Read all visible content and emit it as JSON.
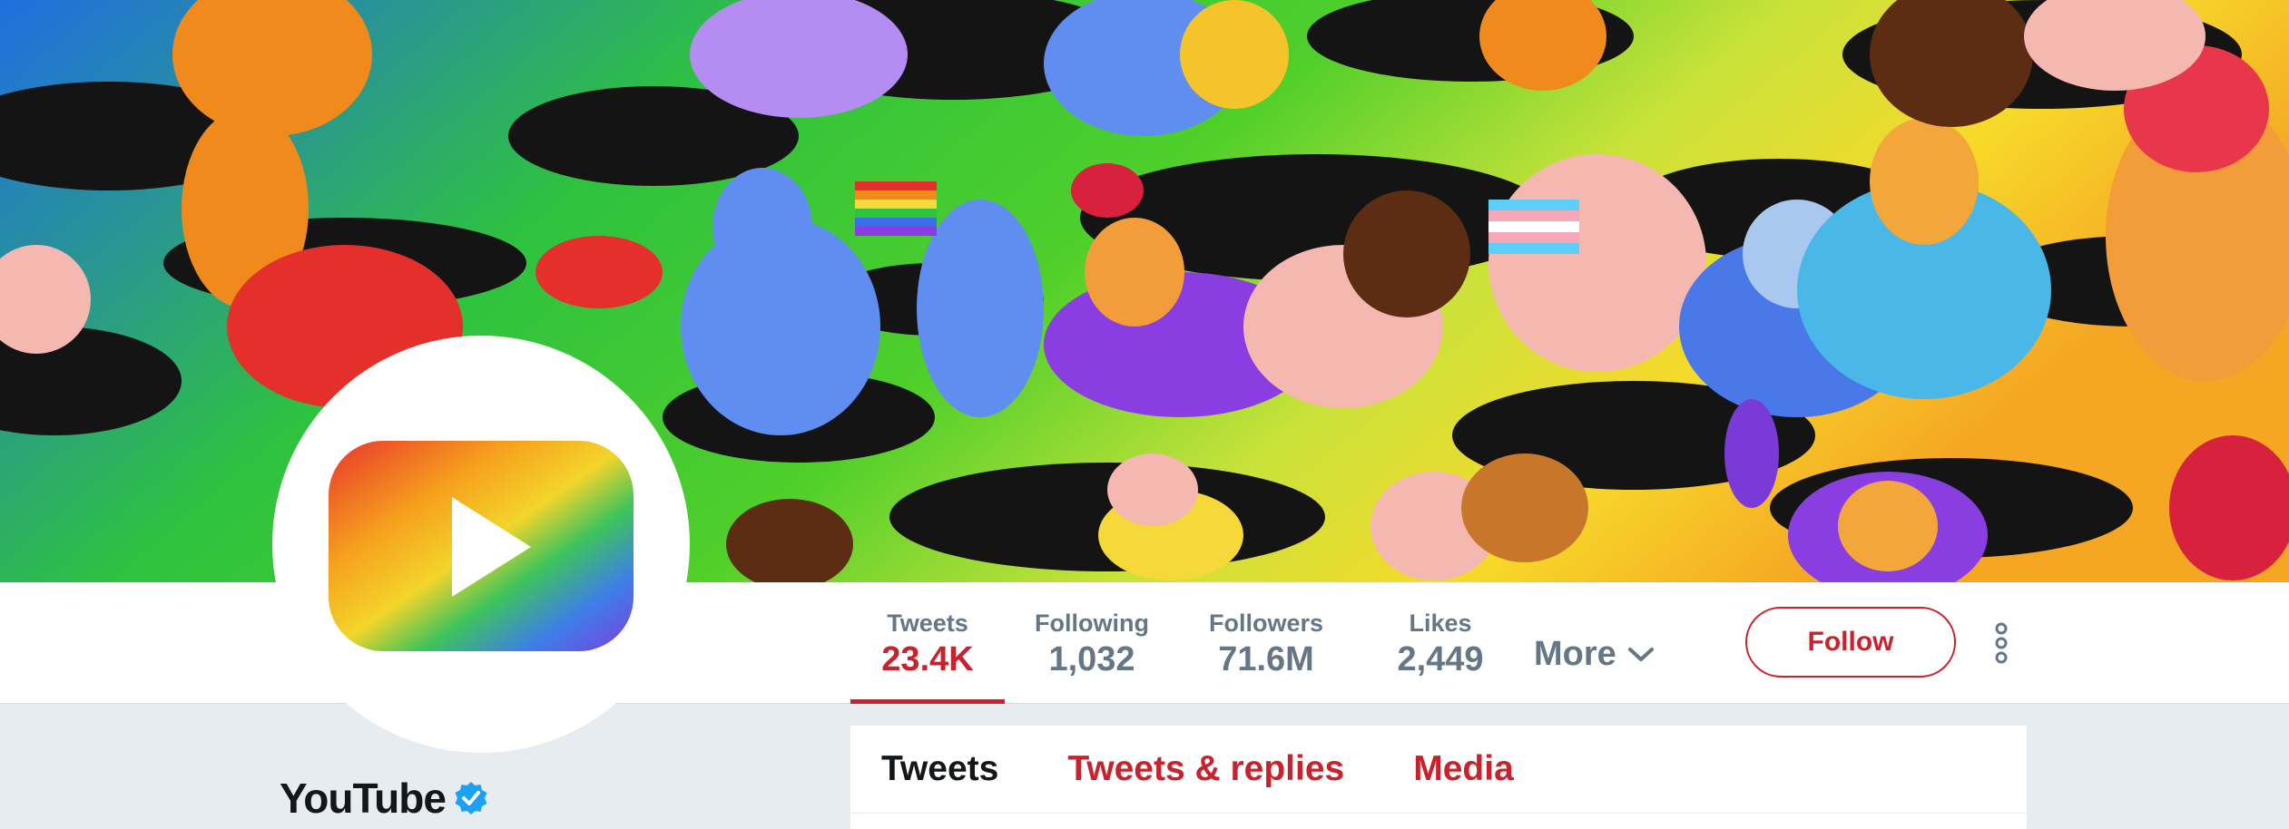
{
  "profile": {
    "name": "YouTube",
    "verified": true,
    "verified_icon": "verified-badge-icon",
    "avatar_icon": "youtube-play-logo"
  },
  "stats": [
    {
      "label": "Tweets",
      "value": "23.4K"
    },
    {
      "label": "Following",
      "value": "1,032"
    },
    {
      "label": "Followers",
      "value": "71.6M"
    },
    {
      "label": "Likes",
      "value": "2,449"
    }
  ],
  "more": {
    "label": "More",
    "icon": "chevron-down-icon"
  },
  "actions": {
    "follow_label": "Follow",
    "overflow_icon": "vertical-dots-icon"
  },
  "timeline_tabs": [
    {
      "label": "Tweets",
      "active": true
    },
    {
      "label": "Tweets & replies",
      "active": false
    },
    {
      "label": "Media",
      "active": false
    }
  ],
  "colors": {
    "accent": "#c8232c",
    "muted": "#657786",
    "text": "#14171a",
    "verified": "#1da1f2",
    "background": "#e6ecf0"
  }
}
